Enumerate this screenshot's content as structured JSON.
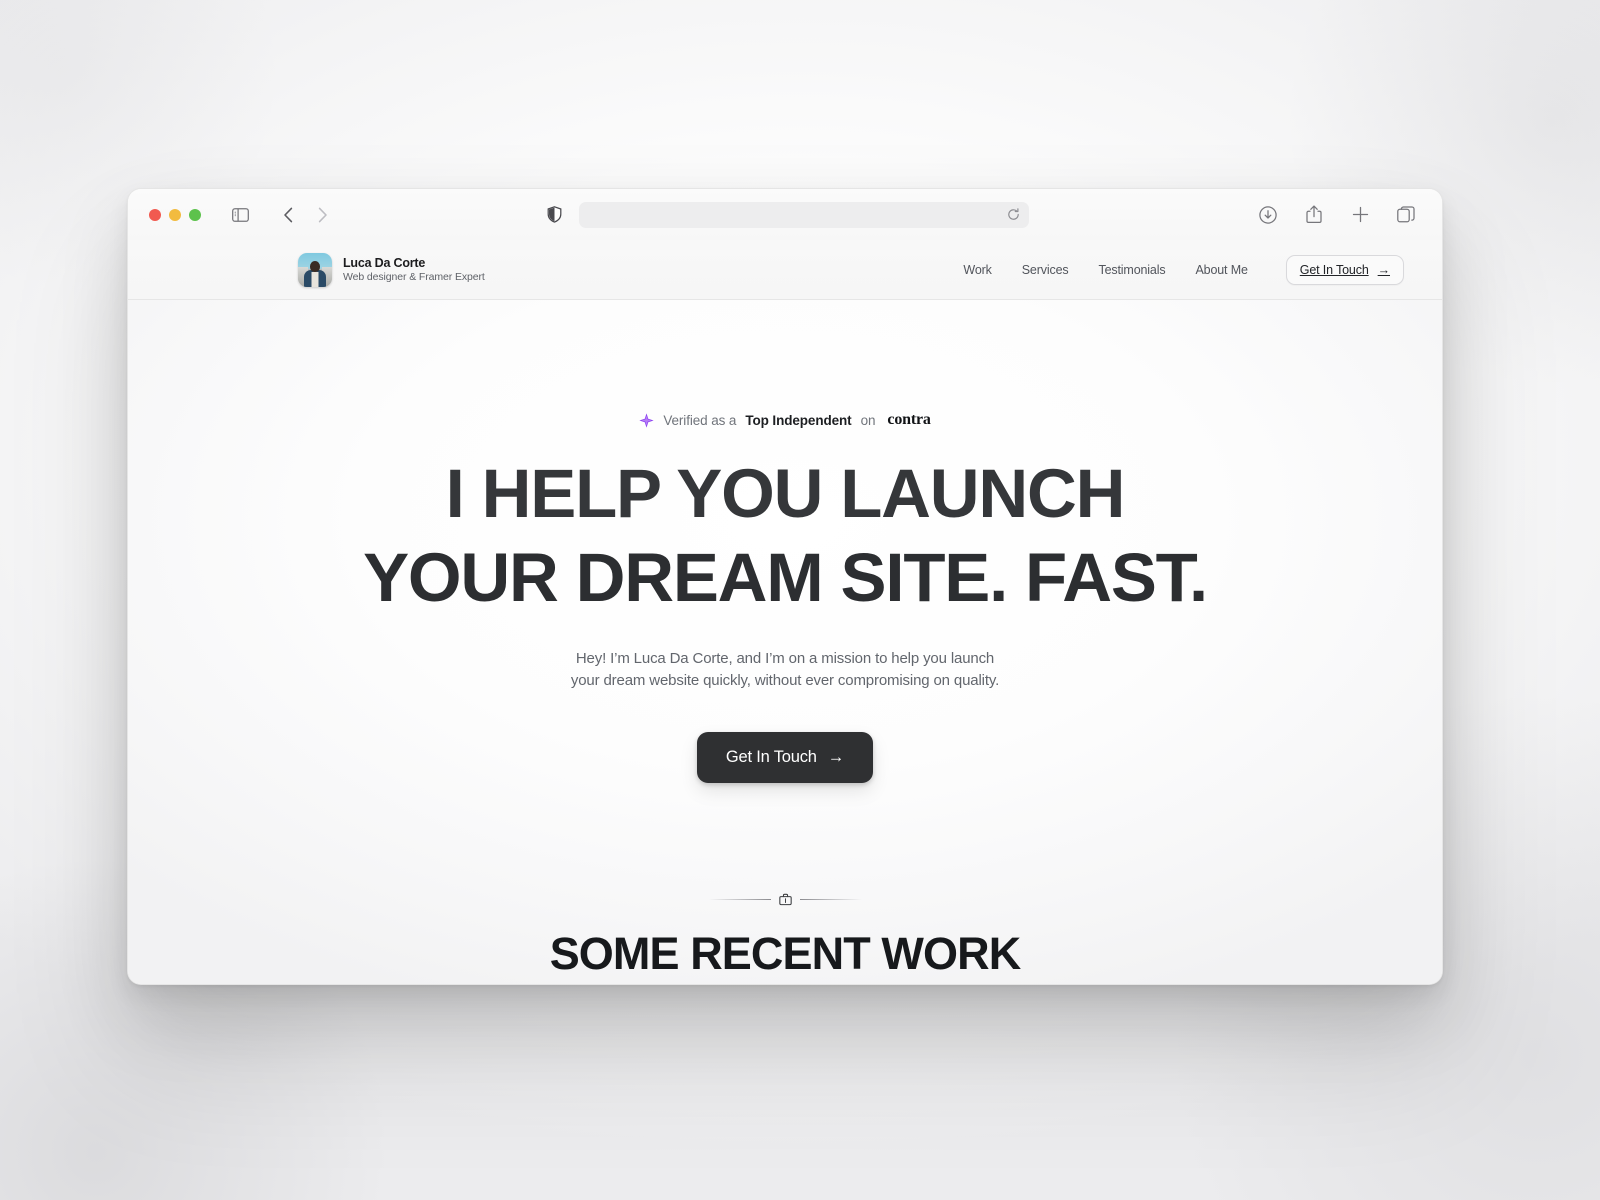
{
  "browser": {
    "traffic_lights": [
      "close",
      "minimize",
      "maximize"
    ],
    "sidebar_toggle": "sidebar-toggle-icon",
    "back": "back-arrow-icon",
    "forward": "forward-arrow-icon",
    "shield": "privacy-shield-icon",
    "address_value": "",
    "address_placeholder": "",
    "reload": "reload-icon",
    "downloads": "downloads-icon",
    "share": "share-icon",
    "new_tab": "plus-icon",
    "tab_overview": "tab-overview-icon"
  },
  "site_header": {
    "avatar_alt": "Luca Da Corte portrait",
    "brand_name": "Luca Da Corte",
    "brand_role": "Web designer & Framer Expert",
    "nav": [
      {
        "label": "Work"
      },
      {
        "label": "Services"
      },
      {
        "label": "Testimonials"
      },
      {
        "label": "About Me"
      }
    ],
    "cta_label": "Get In Touch",
    "cta_arrow": "→"
  },
  "hero": {
    "badge": {
      "icon": "sparkle-icon",
      "prefix": "Verified as a",
      "highlight": "Top Independent",
      "connector": "on",
      "platform": "contra"
    },
    "headline_line1": "I HELP YOU LAUNCH",
    "headline_line2": "YOUR DREAM SITE. FAST.",
    "subhead_line1": "Hey! I’m Luca Da Corte, and I’m on a mission to help you launch",
    "subhead_line2": "your dream website quickly, without ever compromising on quality.",
    "cta_label": "Get In Touch",
    "cta_arrow": "→"
  },
  "work_section": {
    "divider_icon": "briefcase-icon",
    "title": "SOME RECENT WORK"
  },
  "colors": {
    "page_background": "#ffffff",
    "headline_text": "#35373a",
    "body_text": "#62666d",
    "cta_background": "#2f3032",
    "cta_text": "#ffffff",
    "badge_sparkle": "#8b3ff0",
    "traffic_red": "#f15a50",
    "traffic_yellow": "#f2bb3f",
    "traffic_green": "#5dc24c"
  }
}
